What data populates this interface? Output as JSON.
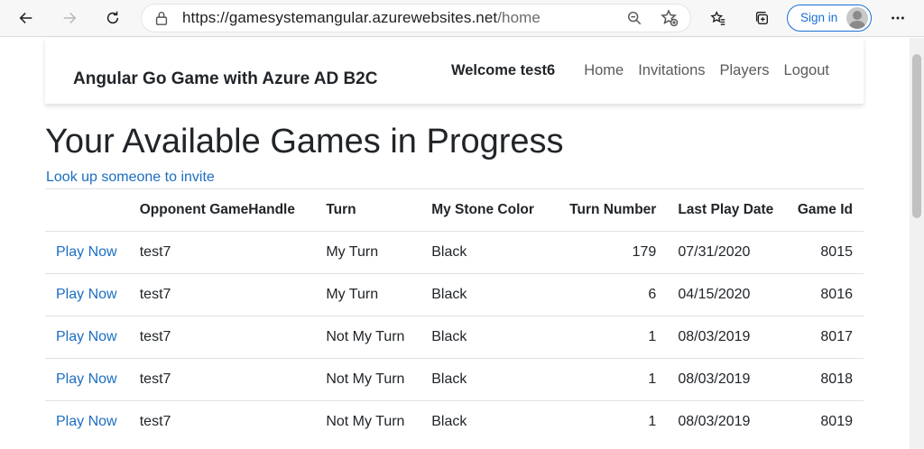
{
  "browser": {
    "url_host": "https://gamesystemangular.azurewebsites.net",
    "url_path": "/home",
    "signin_label": "Sign in",
    "icons": [
      "back-icon",
      "forward-icon",
      "refresh-icon",
      "lock-icon",
      "zoom-icon",
      "favorite-add-icon",
      "favorites-icon",
      "collections-icon",
      "more-icon"
    ]
  },
  "navbar": {
    "brand": "Angular Go Game with Azure AD B2C",
    "welcome": "Welcome test6",
    "links": [
      "Home",
      "Invitations",
      "Players",
      "Logout"
    ]
  },
  "main": {
    "title": "Your Available Games in Progress",
    "lookup_link": "Look up someone to invite"
  },
  "table": {
    "headers": [
      "",
      "Opponent GameHandle",
      "Turn",
      "My Stone Color",
      "Turn Number",
      "Last Play Date",
      "Game Id"
    ],
    "rows": [
      {
        "action": "Play Now",
        "opponent": "test7",
        "turn": "My Turn",
        "color": "Black",
        "turn_number": "179",
        "last_play": "07/31/2020",
        "game_id": "8015"
      },
      {
        "action": "Play Now",
        "opponent": "test7",
        "turn": "My Turn",
        "color": "Black",
        "turn_number": "6",
        "last_play": "04/15/2020",
        "game_id": "8016"
      },
      {
        "action": "Play Now",
        "opponent": "test7",
        "turn": "Not My Turn",
        "color": "Black",
        "turn_number": "1",
        "last_play": "08/03/2019",
        "game_id": "8017"
      },
      {
        "action": "Play Now",
        "opponent": "test7",
        "turn": "Not My Turn",
        "color": "Black",
        "turn_number": "1",
        "last_play": "08/03/2019",
        "game_id": "8018"
      },
      {
        "action": "Play Now",
        "opponent": "test7",
        "turn": "Not My Turn",
        "color": "Black",
        "turn_number": "1",
        "last_play": "08/03/2019",
        "game_id": "8019"
      }
    ]
  },
  "colors": {
    "link": "#1b6ec2",
    "signin_accent": "#1a6fd6",
    "text": "#212529"
  }
}
